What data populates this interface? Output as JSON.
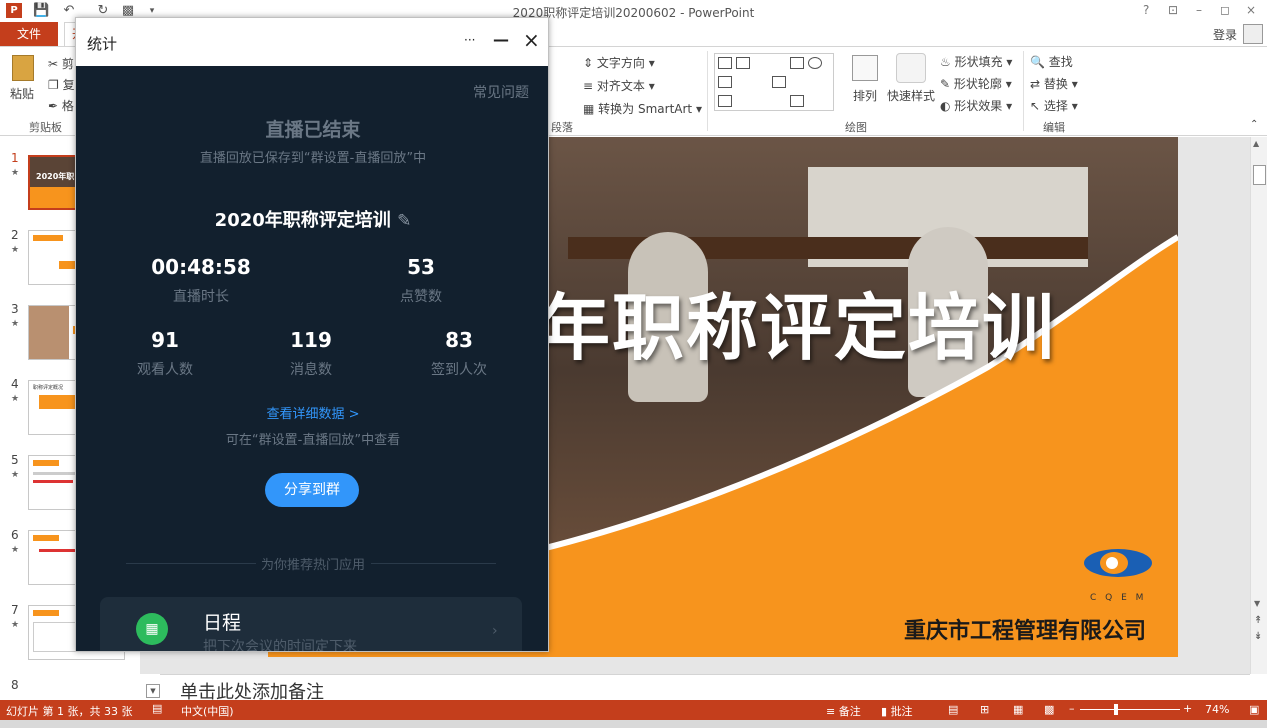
{
  "window": {
    "title": "2020职称评定培训20200602 - PowerPoint",
    "controls": [
      "?",
      "⊡",
      "–",
      "◻",
      "×"
    ]
  },
  "tabs": {
    "file": "文件",
    "home": "开",
    "login": "登录"
  },
  "ribbon": {
    "clipboard": {
      "paste": "粘贴",
      "cut": "剪",
      "copy": "复",
      "format": "格",
      "group": "剪贴板"
    },
    "paragraph": {
      "text_direction": "文字方向",
      "align_text": "对齐文本",
      "smartart": "转换为 SmartArt",
      "group": "段落"
    },
    "drawing": {
      "arrange": "排列",
      "quick_styles": "快速样式",
      "shape_fill": "形状填充",
      "shape_outline": "形状轮廓",
      "shape_effects": "形状效果",
      "group": "绘图"
    },
    "editing": {
      "find": "查找",
      "replace": "替换",
      "select": "选择",
      "group": "编辑"
    }
  },
  "thumbnails": [
    {
      "num": "1",
      "label": "2020年职"
    },
    {
      "num": "2",
      "label": ""
    },
    {
      "num": "3",
      "label": ""
    },
    {
      "num": "4",
      "label": "职称评定概况"
    },
    {
      "num": "5",
      "label": ""
    },
    {
      "num": "6",
      "label": ""
    },
    {
      "num": "7",
      "label": ""
    },
    {
      "num": "8",
      "label": ""
    }
  ],
  "slide": {
    "title": "年职称评定培训",
    "company": "重庆市工程管理有限公司",
    "logo_text": "C Q E M"
  },
  "notes": {
    "placeholder": "单击此处添加备注"
  },
  "status": {
    "slide_info": "幻灯片 第 1 张，共 33 张",
    "language": "中文(中国)",
    "notes": "备注",
    "comments": "批注",
    "zoom": "74%"
  },
  "panel": {
    "title": "统计",
    "more": "···",
    "minimize": "—",
    "close": "×",
    "faq": "常见问题",
    "ended": "直播已结束",
    "saved_note": "直播回放已保存到“群设置-直播回放”中",
    "live_title": "2020年职称评定培训",
    "stats_row1": [
      {
        "value": "00:48:58",
        "label": "直播时长"
      },
      {
        "value": "53",
        "label": "点赞数"
      }
    ],
    "stats_row2": [
      {
        "value": "91",
        "label": "观看人数"
      },
      {
        "value": "119",
        "label": "消息数"
      },
      {
        "value": "83",
        "label": "签到人次"
      }
    ],
    "detail_link": "查看详细数据 >",
    "detail_note": "可在“群设置-直播回放”中查看",
    "share_button": "分享到群",
    "recommend_header": "为你推荐热门应用",
    "app": {
      "name": "日程",
      "desc": "把下次会议的时间定下来"
    }
  },
  "colors": {
    "accent": "#c43e1c",
    "panel_bg": "#12202e",
    "share_button": "#3296fa",
    "slide_orange": "#f7941d",
    "app_green": "#2dbb5d"
  }
}
